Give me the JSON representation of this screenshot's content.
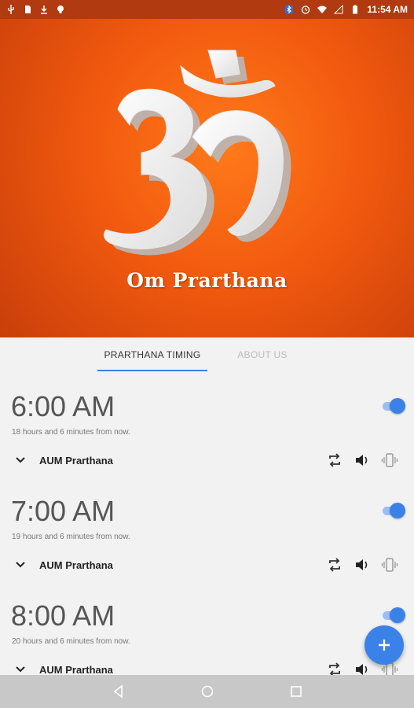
{
  "status_bar": {
    "time": "11:54 AM",
    "left_icons": [
      "usb-icon",
      "sim-icon",
      "download-icon",
      "lightbulb-icon"
    ],
    "right_icons": [
      "bluetooth-icon",
      "alarm-icon",
      "wifi-icon",
      "signal-icon",
      "battery-icon"
    ]
  },
  "hero": {
    "title": "Om Prarthana",
    "background_color": "#f25a0f"
  },
  "tabs": [
    {
      "label": "PRARTHANA TIMING",
      "active": true
    },
    {
      "label": "ABOUT US",
      "active": false
    }
  ],
  "alarms": [
    {
      "time": "6:00 AM",
      "subtitle": "18 hours and 6 minutes from now.",
      "label": "AUM Prarthana",
      "enabled": true
    },
    {
      "time": "7:00 AM",
      "subtitle": "19 hours and 6 minutes from now.",
      "label": "AUM Prarthana",
      "enabled": true
    },
    {
      "time": "8:00 AM",
      "subtitle": "20 hours and 6 minutes from now.",
      "label": "AUM Prarthana",
      "enabled": true
    }
  ],
  "fab": {
    "icon": "plus-icon",
    "color": "#3b82e8"
  },
  "nav_bar": {
    "icons": [
      "back-icon",
      "home-icon",
      "recents-icon"
    ]
  },
  "colors": {
    "accent": "#3b82e8",
    "status_bar": "#b23a10"
  }
}
